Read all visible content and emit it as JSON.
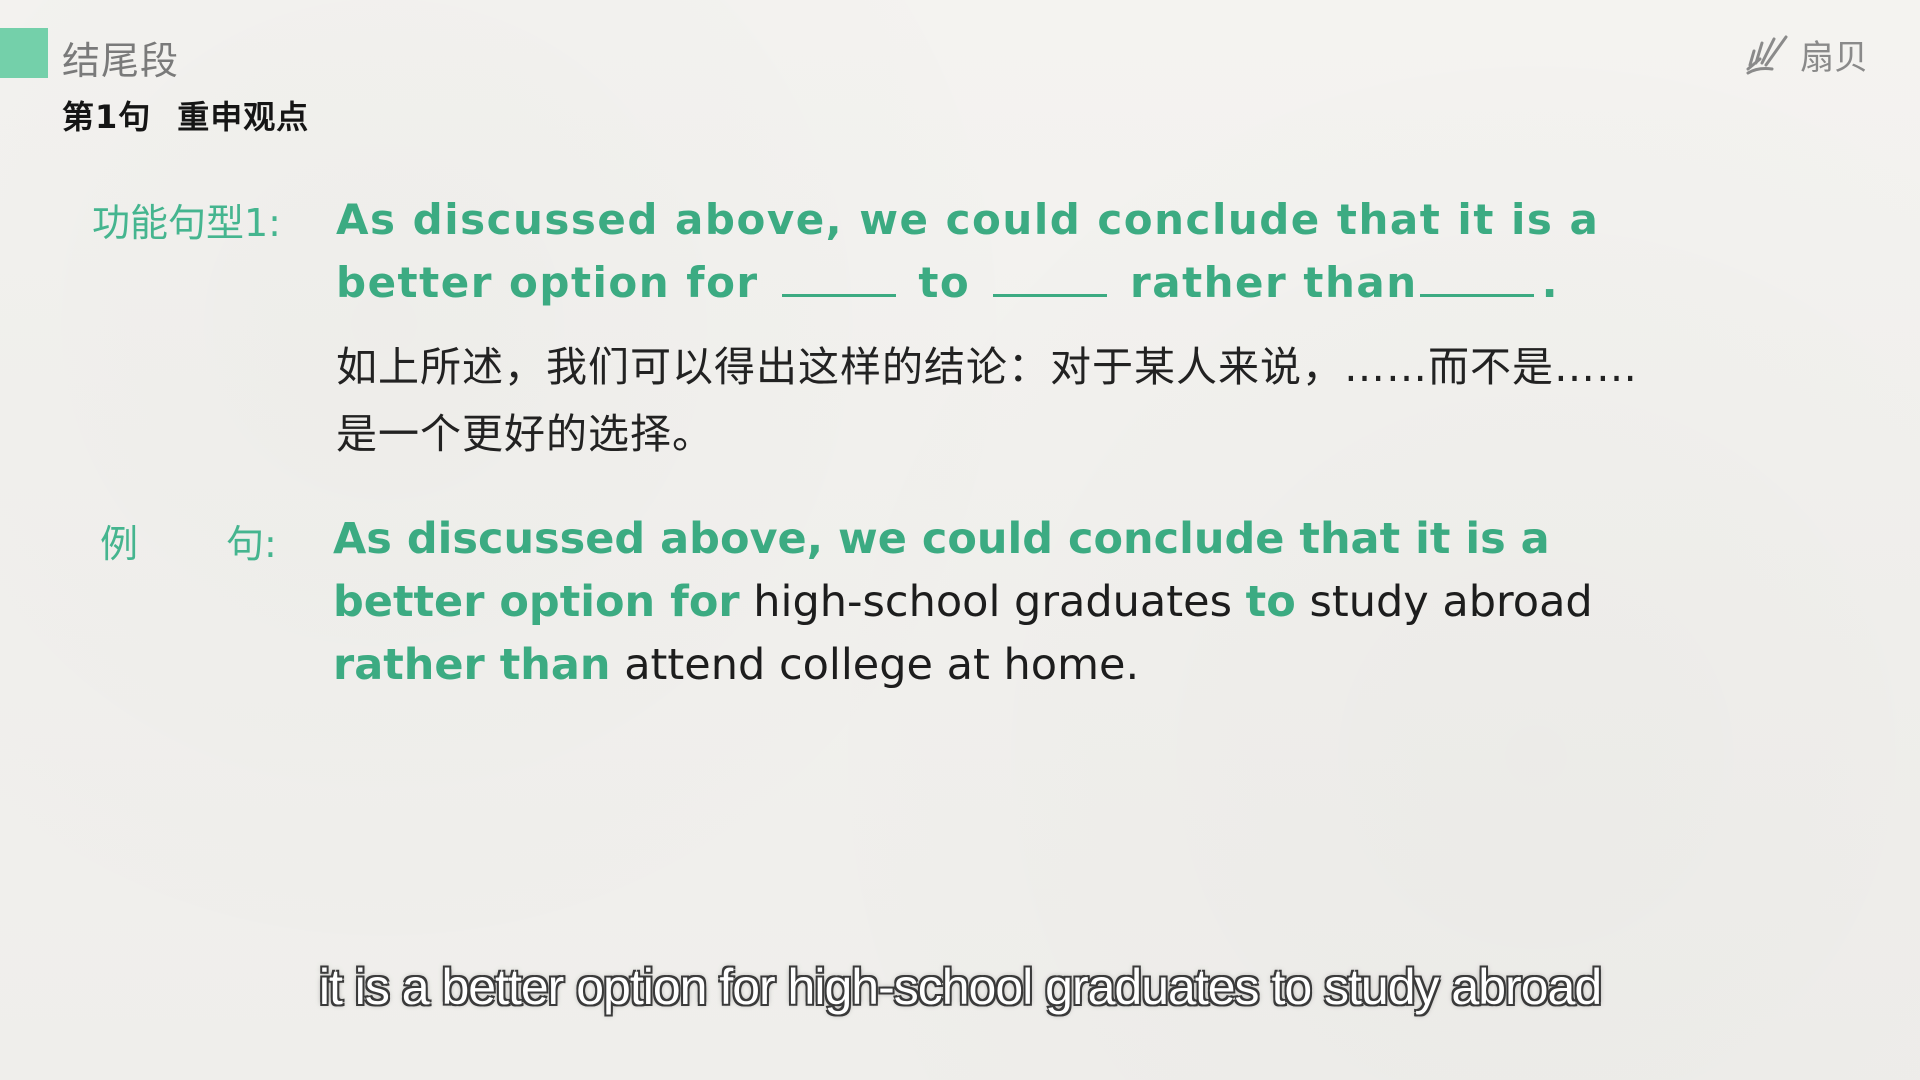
{
  "header": {
    "section_title": "结尾段",
    "sentence_no": "第1句",
    "sentence_topic": "重申观点",
    "logo_text": "扇贝"
  },
  "pattern": {
    "label": "功能句型1:",
    "seg1": "As discussed above, we could conclude that it is a better option for",
    "seg2": "to",
    "seg3": "rather than",
    "end": ".",
    "translation": "如上所述，我们可以得出这样的结论：对于某人来说，……而不是……是一个更好的选择。"
  },
  "example": {
    "label_a": "例",
    "label_b": "句:",
    "green1": "As discussed above, we could conclude that it is a better option for",
    "plain1": "high-school graduates",
    "green2": "to",
    "plain2": "study abroad",
    "green3": "rather than",
    "plain3": "attend college at home."
  },
  "caption": {
    "text": "it is a better option for high-school graduates to study abroad"
  },
  "colors": {
    "accent": "#74d0aa",
    "green_text": "#3cab82",
    "label_green": "#45b58f"
  },
  "icons": {
    "logo": "shell-rays-icon"
  }
}
